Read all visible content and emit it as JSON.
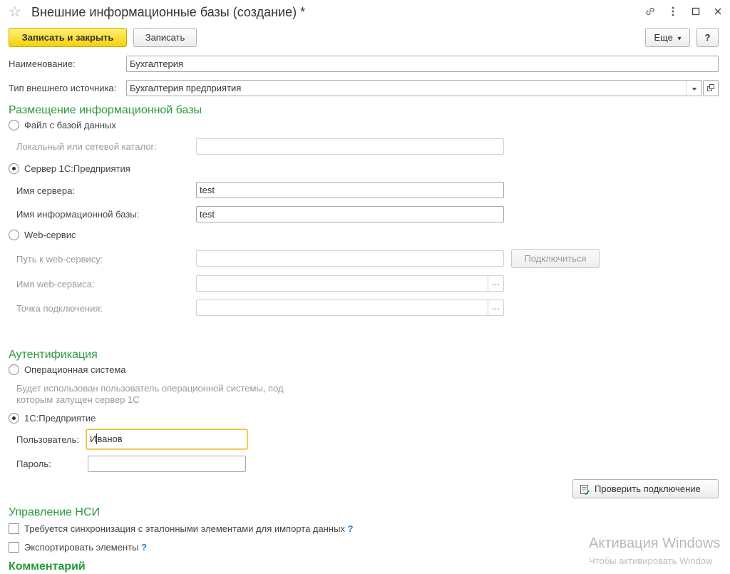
{
  "window": {
    "title": "Внешние информационные базы (создание) *",
    "star_glyph": "☆"
  },
  "toolbar": {
    "save_close_label": "Записать и закрыть",
    "save_label": "Записать",
    "more_label": "Еще",
    "more_arrow": "▾",
    "help_label": "?"
  },
  "form": {
    "name_label": "Наименование:",
    "name_value": "Бухгалтерия",
    "source_type_label": "Тип внешнего источника:",
    "source_type_value": "Бухгалтерия предприятия"
  },
  "placement": {
    "section_title": "Размещение информационной базы",
    "file_option": "Файл с базой данных",
    "local_dir_label": "Локальный или сетевой каталог:",
    "local_dir_value": "",
    "server_option": "Сервер 1С:Предприятия",
    "server_name_label": "Имя сервера:",
    "server_name_value": "test",
    "ib_name_label": "Имя информационной базы:",
    "ib_name_value": "test",
    "web_option": "Web-сервис",
    "web_path_label": "Путь к web-сервису:",
    "web_path_value": "",
    "connect_label": "Подключиться",
    "web_name_label": "Имя web-сервиса:",
    "web_name_value": "",
    "endpoint_label": "Точка подключения:",
    "endpoint_value": "",
    "selected": "server"
  },
  "auth": {
    "section_title": "Аутентификация",
    "os_option": "Операционная система",
    "os_note_line1": "Будет использован пользователь операционной системы, под",
    "os_note_line2": "которым запущен сервер 1С",
    "ent_option": "1С:Предприятие",
    "user_label": "Пользователь:",
    "user_value_before": "И",
    "user_value_after": "ванов",
    "password_label": "Пароль:",
    "password_value": "",
    "check_connection_label": "Проверить подключение",
    "selected": "enterprise"
  },
  "nsi": {
    "section_title": "Управление НСИ",
    "sync_label": "Требуется синхронизация с эталонными элементами для импорта данных",
    "sync_checked": false,
    "export_label": "Экспортировать элементы",
    "export_checked": false,
    "help_mark": "?"
  },
  "comment": {
    "section_title": "Комментарий"
  },
  "watermark": {
    "line1": "Активация Windows",
    "line2": "Чтобы активировать Window"
  },
  "icons": {
    "link": "link-icon",
    "menu": "more-vertical-icon",
    "minimize": "minimize-icon",
    "close": "close-icon",
    "dropdown": "chevron-down-icon",
    "open": "open-window-icon",
    "ellipsis": "ellipsis-icon",
    "check_connection": "check-document-icon"
  },
  "colors": {
    "accent_green": "#2a9a3d",
    "primary_yellow": "#f5d10a",
    "help_blue": "#2d7fc7"
  }
}
